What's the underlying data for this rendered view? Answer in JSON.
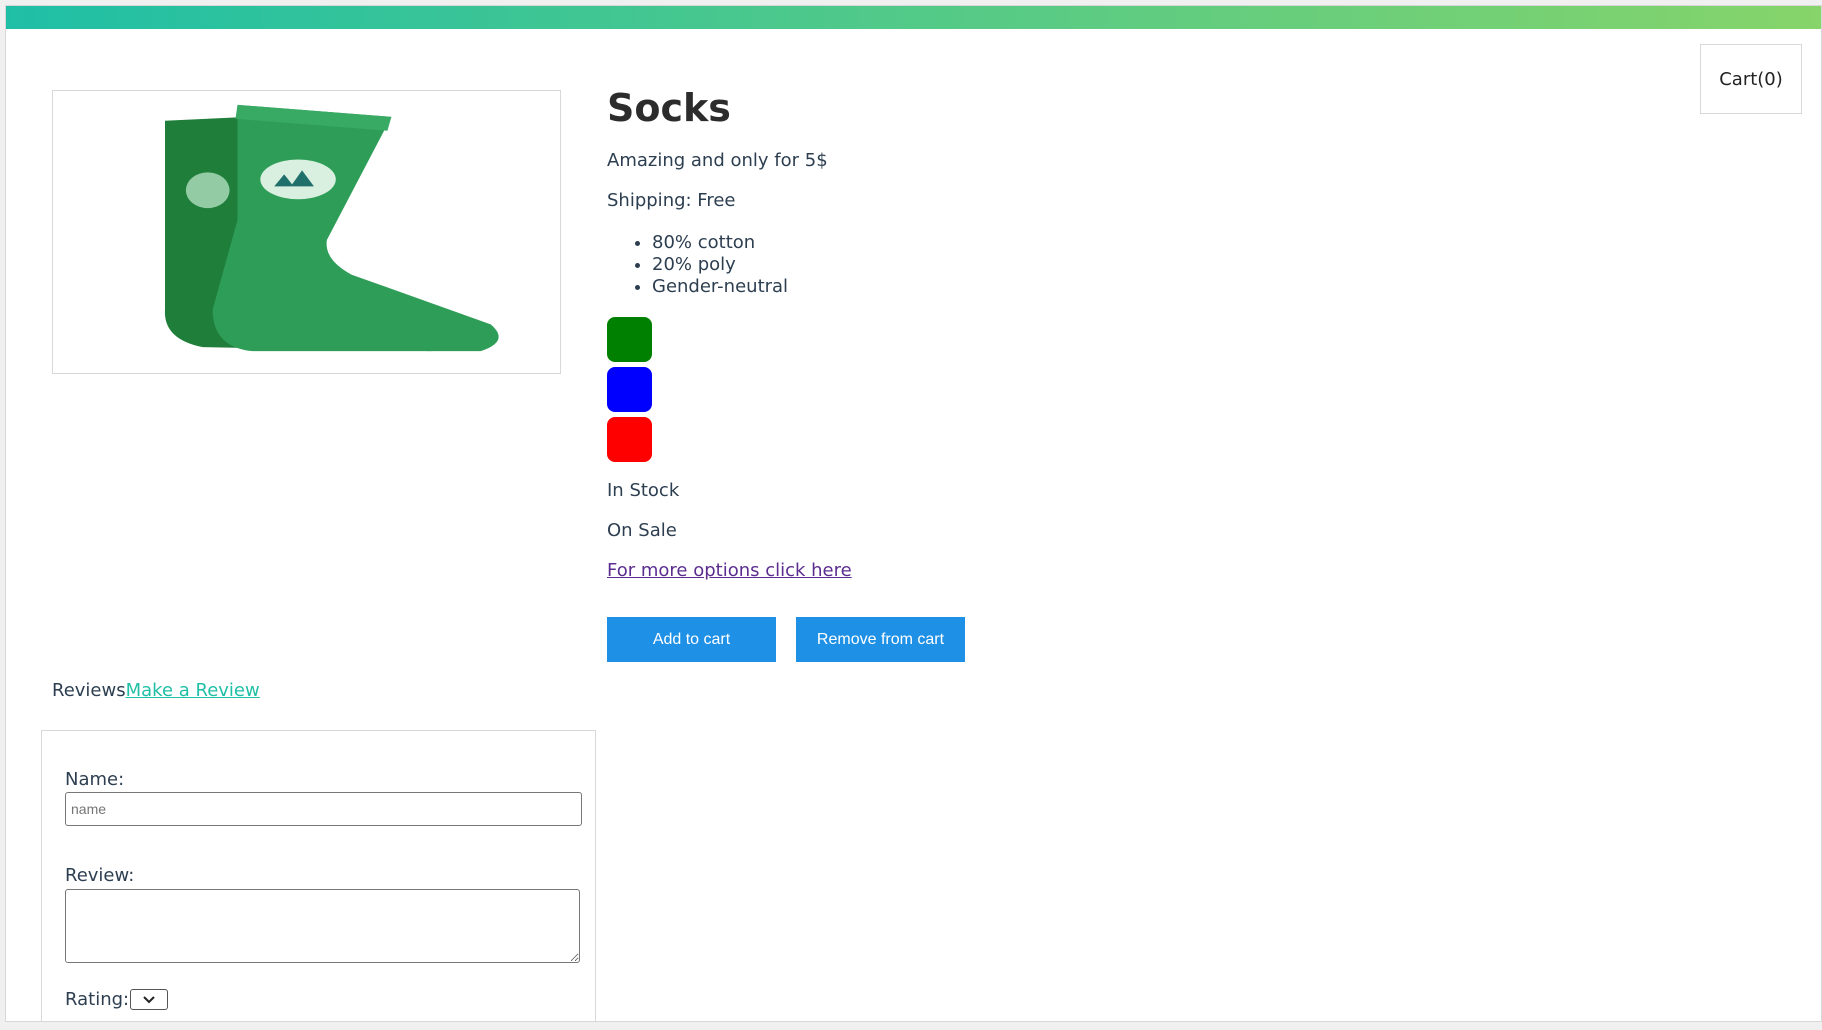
{
  "header": {
    "cart_label": "Cart(0)"
  },
  "product": {
    "title": "Socks",
    "description": "Amazing and only for 5$",
    "shipping": "Shipping: Free",
    "details": [
      "80% cotton",
      "20% poly",
      "Gender-neutral"
    ],
    "variants": [
      {
        "color": "#008000"
      },
      {
        "color": "#0000ff"
      },
      {
        "color": "#ff0000"
      }
    ],
    "stock_status": "In Stock",
    "sale_status": "On Sale",
    "more_options_link": "For more options click here",
    "add_button": "Add to cart",
    "remove_button": "Remove from cart"
  },
  "reviews": {
    "heading": "Reviews",
    "make_review_link": "Make a Review",
    "form": {
      "name_label": "Name:",
      "name_placeholder": "name",
      "review_label": "Review:",
      "rating_label": "Rating:"
    }
  },
  "colors": {
    "accent_start": "#1fbfa6",
    "accent_end": "#86d46a",
    "button": "#1e90e5"
  }
}
